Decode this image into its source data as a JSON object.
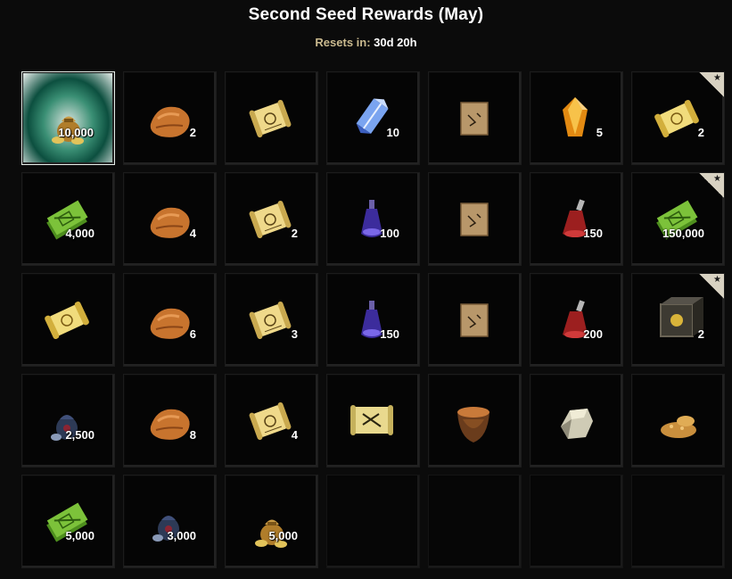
{
  "header": {
    "title": "Second Seed Rewards (May)",
    "resets_label": "Resets in:",
    "resets_value": "30d 20h"
  },
  "icon_names": {
    "gold-pouch": "gold-pouch-icon",
    "bread": "bread-icon",
    "scroll": "scroll-icon",
    "crystal": "crystal-icon",
    "treasure-map": "treasure-map-icon",
    "gem": "gem-icon",
    "tickets": "tickets-icon",
    "potion-purple": "potion-purple-icon",
    "potion-red": "potion-red-icon",
    "crate": "crate-icon",
    "blue-pouch": "blue-pouch-icon",
    "recipe": "recipe-icon",
    "bowl": "bowl-icon",
    "ore": "ore-icon",
    "grain": "grain-icon"
  },
  "cells": [
    {
      "icon": "gold-pouch",
      "qty": "10,000",
      "selected": true
    },
    {
      "icon": "bread",
      "qty": "2"
    },
    {
      "icon": "scroll",
      "qty": ""
    },
    {
      "icon": "crystal",
      "qty": "10"
    },
    {
      "icon": "treasure-map",
      "qty": ""
    },
    {
      "icon": "gem",
      "qty": "5"
    },
    {
      "icon": "scroll-gold",
      "qty": "2",
      "ribbon": true
    },
    {
      "icon": "tickets",
      "qty": "4,000"
    },
    {
      "icon": "bread",
      "qty": "4"
    },
    {
      "icon": "scroll",
      "qty": "2"
    },
    {
      "icon": "potion-purple",
      "qty": "100"
    },
    {
      "icon": "treasure-map",
      "qty": ""
    },
    {
      "icon": "potion-red",
      "qty": "150"
    },
    {
      "icon": "tickets",
      "qty": "150,000",
      "ribbon": true
    },
    {
      "icon": "scroll-gold",
      "qty": ""
    },
    {
      "icon": "bread",
      "qty": "6"
    },
    {
      "icon": "scroll",
      "qty": "3"
    },
    {
      "icon": "potion-purple",
      "qty": "150"
    },
    {
      "icon": "treasure-map",
      "qty": ""
    },
    {
      "icon": "potion-red",
      "qty": "200"
    },
    {
      "icon": "crate",
      "qty": "2",
      "ribbon": true
    },
    {
      "icon": "blue-pouch",
      "qty": "2,500"
    },
    {
      "icon": "bread",
      "qty": "8"
    },
    {
      "icon": "scroll",
      "qty": "4"
    },
    {
      "icon": "recipe",
      "qty": ""
    },
    {
      "icon": "bowl",
      "qty": ""
    },
    {
      "icon": "ore",
      "qty": ""
    },
    {
      "icon": "grain",
      "qty": ""
    },
    {
      "icon": "tickets",
      "qty": "5,000"
    },
    {
      "icon": "blue-pouch",
      "qty": "3,000"
    },
    {
      "icon": "gold-pouch",
      "qty": "5,000"
    },
    {
      "icon": "",
      "qty": "",
      "empty": true
    },
    {
      "icon": "",
      "qty": "",
      "empty": true
    },
    {
      "icon": "",
      "qty": "",
      "empty": true
    },
    {
      "icon": "",
      "qty": "",
      "empty": true
    }
  ],
  "colors": {
    "background": "#0b0b0b",
    "label_gold": "#c9b98e",
    "selected_glow": "#3a8f74"
  }
}
